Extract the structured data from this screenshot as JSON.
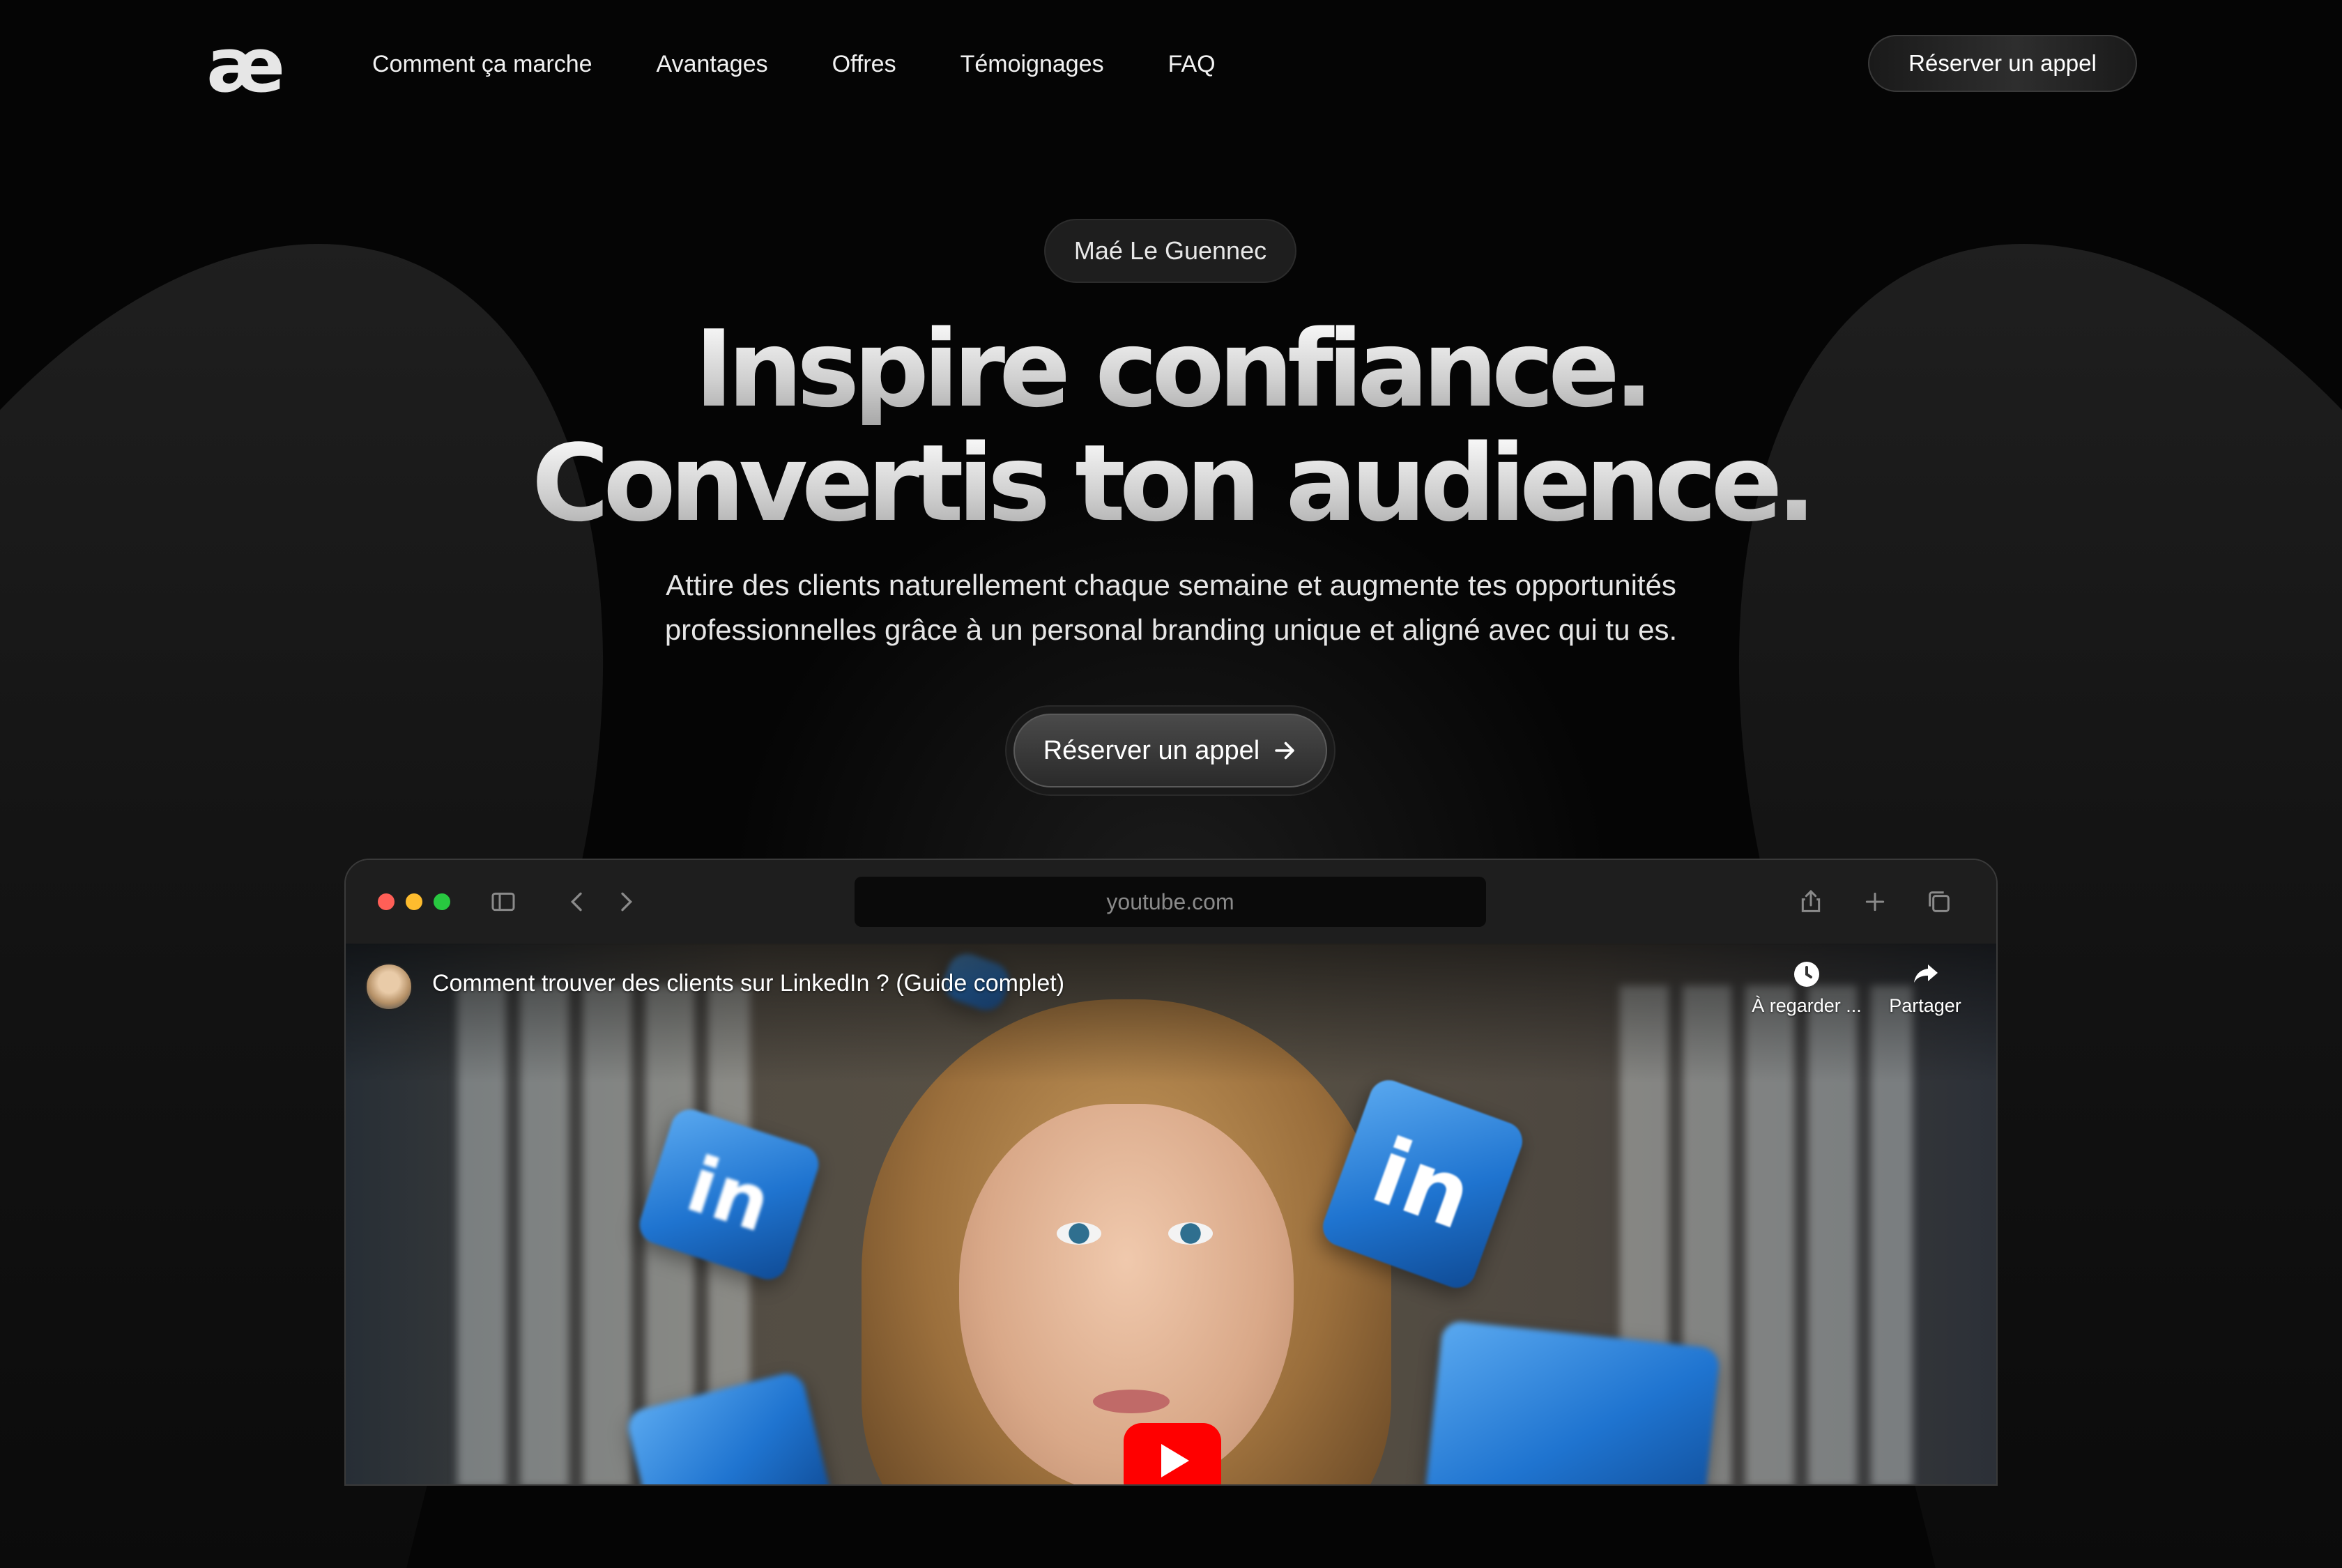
{
  "nav": {
    "logo": "æ",
    "links": [
      "Comment ça marche",
      "Avantages",
      "Offres",
      "Témoignages",
      "FAQ"
    ],
    "cta_label": "Réserver un appel"
  },
  "hero": {
    "badge": "Maé Le Guennec",
    "headline_line1": "Inspire confiance.",
    "headline_line2": "Convertis ton audience.",
    "subtitle_line1": "Attire des clients naturellement chaque semaine et augmente tes opportunités",
    "subtitle_line2": "professionnelles grâce à un personal branding unique et aligné avec qui tu es.",
    "cta_label": "Réserver un appel"
  },
  "browser": {
    "url": "youtube.com",
    "icons": [
      "sidebar-icon",
      "chevron-left-icon",
      "chevron-right-icon",
      "share-icon",
      "plus-icon",
      "tabs-icon"
    ]
  },
  "video": {
    "title": "Comment trouver des clients sur LinkedIn ? (Guide complet)",
    "watch_later_label": "À regarder ...",
    "share_label": "Partager",
    "cube_text": "in"
  },
  "colors": {
    "background": "#050505",
    "traffic_red": "#ff5f57",
    "traffic_yellow": "#febc2e",
    "traffic_green": "#28c840",
    "youtube_red": "#ff0000",
    "linkedin_blue": "#1f74d0"
  }
}
